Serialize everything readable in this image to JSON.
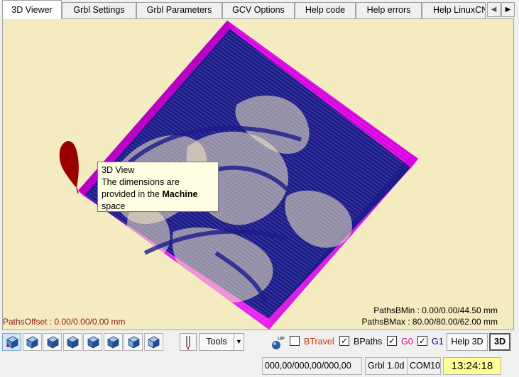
{
  "tabs": [
    {
      "label": "3D Viewer",
      "active": true
    },
    {
      "label": "Grbl Settings"
    },
    {
      "label": "Grbl Parameters"
    },
    {
      "label": "GCV Options"
    },
    {
      "label": "Help code"
    },
    {
      "label": "Help errors"
    },
    {
      "label": "Help LinuxCNC"
    }
  ],
  "tab_scroll": {
    "left": "◀",
    "right": "▶"
  },
  "tooltip": {
    "line1": "3D View",
    "line2": "The dimensions are",
    "line3_prefix": "provided in the ",
    "line3_bold": "Machine",
    "line4": "space"
  },
  "viewer": {
    "paths_offset": "PathsOffset : 0.00/0.00/0.00 mm",
    "paths_bmin": "PathsBMin : 0.00/0.00/44.50 mm",
    "paths_bmax": "PathsBMax : 80.00/80.00/62.00 mm",
    "colors": {
      "background": "#f4ebc1",
      "toolpath": "#1c1c8c",
      "travel": "#ff00ff",
      "tool": "#9b0000"
    }
  },
  "toolbar": {
    "view_buttons": [
      "view-iso-icon",
      "view-top-icon",
      "view-front-icon",
      "view-back-icon",
      "view-left-icon",
      "view-right-icon",
      "view-bottom-icon",
      "view-reset-icon"
    ],
    "tools_label": "Tools",
    "checkboxes": [
      {
        "label": "BTravel",
        "checked": false,
        "color": "#cc3300"
      },
      {
        "label": "BPaths",
        "checked": true,
        "color": "#000000"
      },
      {
        "label": "G0",
        "checked": true,
        "color": "#e0007a"
      },
      {
        "label": "G1",
        "checked": true,
        "color": "#000080"
      }
    ],
    "check_mark": "✓",
    "help3d_label": "Help 3D",
    "btn3d_label": "3D"
  },
  "statusbar": {
    "coords": "000,00/000,00/000,00",
    "grbl_version": "Grbl 1.0d",
    "port": "COM10",
    "clock": "13:24:18"
  }
}
